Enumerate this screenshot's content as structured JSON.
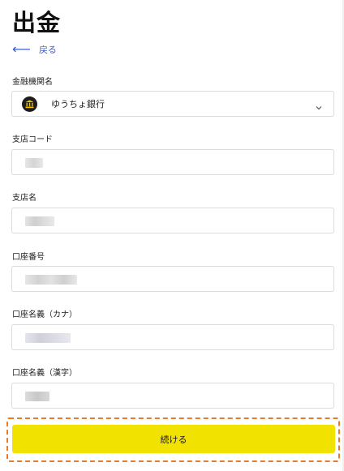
{
  "page": {
    "title": "出金",
    "back_label": "戻る",
    "back_icon": "arrow-left-icon"
  },
  "form": {
    "bank": {
      "label": "金融機関名",
      "value": "ゆうちょ銀行",
      "logo_icon": "bank-logo-icon",
      "dropdown_icon": "chevron-down-icon"
    },
    "branch_code": {
      "label": "支店コード",
      "value_masked": true
    },
    "branch_name": {
      "label": "支店名",
      "value_masked": true
    },
    "account_number": {
      "label": "口座番号",
      "value_masked": true
    },
    "account_holder_kana": {
      "label": "口座名義（カナ）",
      "value_masked": true
    },
    "account_holder_kanji": {
      "label": "口座名義（漢字）",
      "value_masked": true
    }
  },
  "actions": {
    "continue_label": "続ける"
  },
  "colors": {
    "accent_button": "#f2e200",
    "highlight_outline": "#e87b2a",
    "link": "#3a5fd0"
  }
}
